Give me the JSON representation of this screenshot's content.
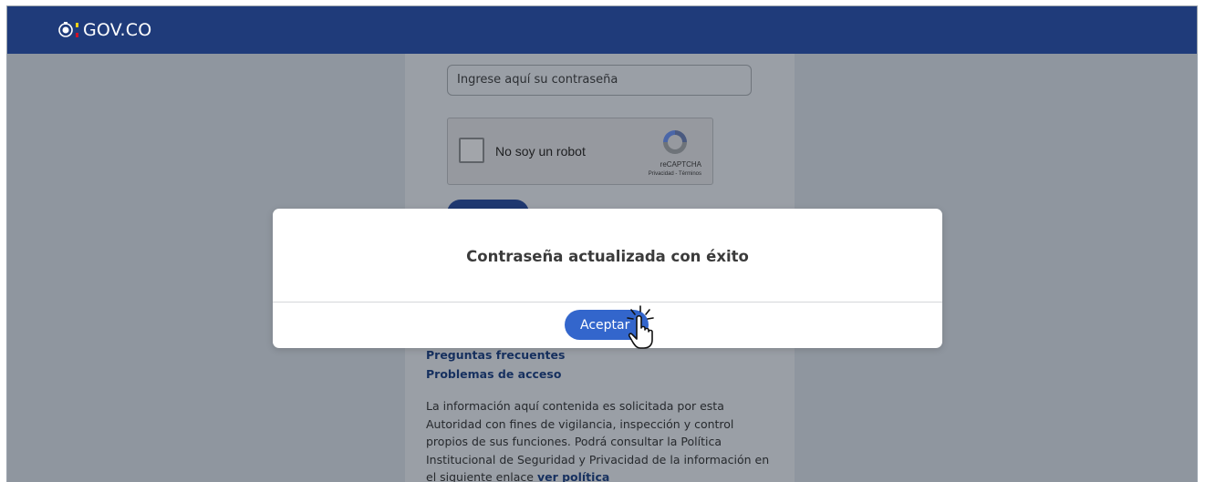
{
  "header": {
    "logo_text": "GOV.CO",
    "background_color": "#1f3b7a",
    "shield_icon": "shield-icon"
  },
  "form": {
    "password_placeholder": "Ingrese aquí su contraseña",
    "recaptcha": {
      "label": "No soy un robot",
      "brand": "reCAPTCHA",
      "links": "Privacidad - Términos"
    },
    "links": {
      "faq": "Preguntas frecuentes",
      "access_problems": "Problemas de acceso"
    },
    "info_text": "La información aquí contenida es solicitada por esta Autoridad con fines de vigilancia, inspección y control propios de sus funciones. Podrá consultar la Política Institucional de Seguridad y Privacidad de la información en el siguiente enlace",
    "info_link": "ver política"
  },
  "modal": {
    "title": "Contraseña actualizada con éxito",
    "accept_label": "Aceptar",
    "accent_color": "#3366cc"
  }
}
